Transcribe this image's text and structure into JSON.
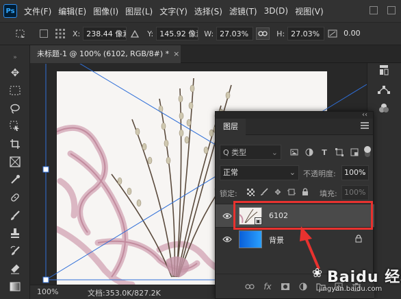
{
  "app": {
    "logo": "Ps"
  },
  "menu": [
    "文件(F)",
    "编辑(E)",
    "图像(I)",
    "图层(L)",
    "文字(Y)",
    "选择(S)",
    "滤镜(T)",
    "3D(D)",
    "视图(V)"
  ],
  "options": {
    "x_label": "X:",
    "x_value": "238.44 像素",
    "y_label": "Y:",
    "y_value": "145.92 像素",
    "w_label": "W:",
    "w_value": "27.03%",
    "h_label": "H:",
    "h_value": "27.03%",
    "angle_value": "0.00"
  },
  "document": {
    "tab_title": "未标题-1 @ 100% (6102, RGB/8#) *",
    "tab_close": "×",
    "zoom": "100%",
    "doc_info": "文档:353.0K/827.2K"
  },
  "layers_panel": {
    "collapse": "‹‹",
    "tab_label": "图层",
    "kind_filter": "Q 类型",
    "blend_mode": "正常",
    "opacity_label": "不透明度:",
    "opacity_value": "100%",
    "lock_label": "锁定:",
    "fill_label": "填充:",
    "fill_value": "100%",
    "layers": [
      {
        "name": "6102",
        "selected": true,
        "kind": "smart-object"
      },
      {
        "name": "背景",
        "selected": false,
        "kind": "background"
      }
    ]
  },
  "colors": {
    "highlight": "#e8322f",
    "selected_layer": "#4a4a4a",
    "transform_lines": "#2f6fd8"
  },
  "watermark": {
    "text": "Baidu 经验",
    "url": "jingyan.baidu.com"
  }
}
